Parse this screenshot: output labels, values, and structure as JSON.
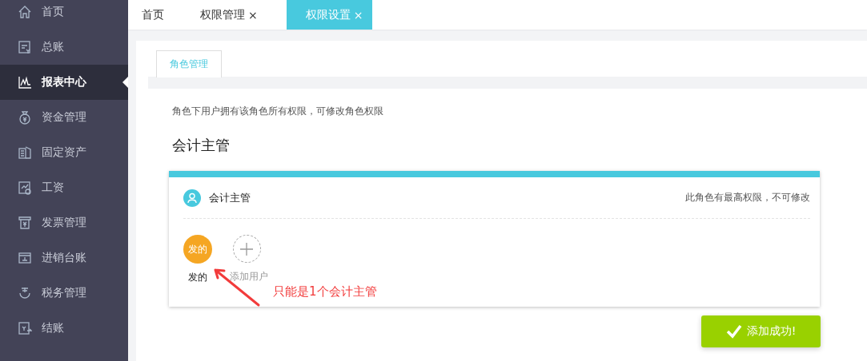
{
  "sidebar": {
    "items": [
      {
        "label": "首页",
        "selected": false
      },
      {
        "label": "总账",
        "selected": false
      },
      {
        "label": "报表中心",
        "selected": true
      },
      {
        "label": "资金管理",
        "selected": false
      },
      {
        "label": "固定资产",
        "selected": false
      },
      {
        "label": "工资",
        "selected": false
      },
      {
        "label": "发票管理",
        "selected": false
      },
      {
        "label": "进销台账",
        "selected": false
      },
      {
        "label": "税务管理",
        "selected": false
      },
      {
        "label": "结账",
        "selected": false
      }
    ]
  },
  "tabs": [
    {
      "label": "首页",
      "selected": false
    },
    {
      "label": "权限管理",
      "close": "×",
      "selected": false
    },
    {
      "label": "权限设置",
      "close": "×",
      "selected": true
    }
  ],
  "panel": {
    "subtabs": [
      {
        "label": "角色管理",
        "selected": true
      }
    ],
    "description": "角色下用户拥有该角色所有权限，可修改角色权限",
    "heading": "会计主管",
    "card": {
      "role": "会计主管",
      "note": "此角色有最高权限，不可修改",
      "users": [
        {
          "avatar": "发的",
          "name": "发的"
        }
      ],
      "add_label": "添加用户",
      "annotation": "只能是1个会计主管"
    }
  },
  "toast": {
    "message": "添加成功!"
  }
}
